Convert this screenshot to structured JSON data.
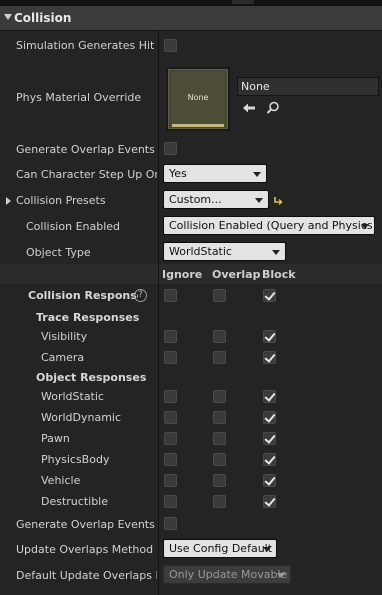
{
  "section": {
    "title": "Collision"
  },
  "rows": {
    "sim_hit": {
      "label": "Simulation Generates Hit Events"
    },
    "phys_material": {
      "label": "Phys Material Override",
      "thumb_text": "None",
      "value": "None"
    },
    "gen_overlap": {
      "label": "Generate Overlap Events"
    },
    "step_up": {
      "label": "Can Character Step Up On",
      "value": "Yes"
    },
    "presets": {
      "label": "Collision Presets",
      "value": "Custom..."
    },
    "enabled": {
      "label": "Collision Enabled",
      "value": "Collision Enabled (Query and Physics)"
    },
    "object_type": {
      "label": "Object Type",
      "value": "WorldStatic"
    },
    "gen_overlap_during": {
      "label": "Generate Overlap Events During Level Streaming"
    },
    "update_overlaps": {
      "label": "Update Overlaps Method During Level Streaming",
      "value": "Use Config Default"
    },
    "default_update": {
      "label": "Default Update Overlaps Method During Level Streaming",
      "value": "Only Update Movable"
    }
  },
  "columns": {
    "ignore": "Ignore",
    "overlap": "Overlap",
    "block": "Block"
  },
  "responses": {
    "label": "Collision Responses",
    "help": "?",
    "trace_title": "Trace Responses",
    "trace": [
      {
        "label": "Visibility",
        "block": true
      },
      {
        "label": "Camera",
        "block": true
      }
    ],
    "object_title": "Object Responses",
    "object": [
      {
        "label": "WorldStatic",
        "block": true
      },
      {
        "label": "WorldDynamic",
        "block": true
      },
      {
        "label": "Pawn",
        "block": true
      },
      {
        "label": "PhysicsBody",
        "block": true
      },
      {
        "label": "Vehicle",
        "block": true
      },
      {
        "label": "Destructible",
        "block": true
      }
    ]
  },
  "colors": {
    "panel": "#242424",
    "header": "#3b3b3b",
    "combo": "#e3e3e3",
    "reset": "#e8c53a"
  }
}
